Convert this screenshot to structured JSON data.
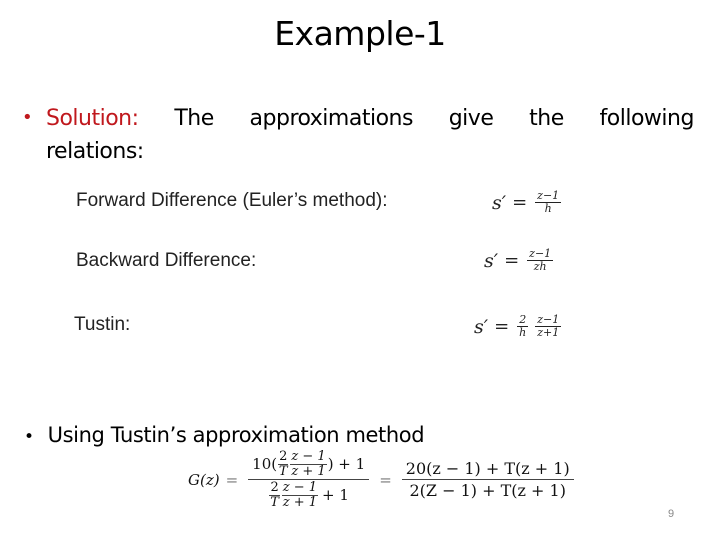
{
  "slide": {
    "title": "Example-1",
    "page_number": "9",
    "accent_color": "#c0181d"
  },
  "solution": {
    "bullet": "•",
    "label": "Solution:",
    "words_line1": [
      "The",
      "approximations",
      "give",
      "the",
      "following"
    ],
    "line2": "relations:"
  },
  "relations": [
    {
      "label": "Forward Difference (Euler’s method):",
      "lhs": "s′",
      "equals": "=",
      "fractions": [
        {
          "num": "z−1",
          "den": "h"
        }
      ]
    },
    {
      "label": "Backward Difference:",
      "lhs": "s′",
      "equals": "=",
      "fractions": [
        {
          "num": "z−1",
          "den": "zh"
        }
      ]
    },
    {
      "label": "Tustin:",
      "lhs": "s′",
      "equals": "=",
      "fractions": [
        {
          "num": "2",
          "den": "h"
        },
        {
          "num": "z−1",
          "den": "z+1"
        }
      ]
    }
  ],
  "tustin_section": {
    "bullet": "•",
    "text": "Using Tustin’s approximation method",
    "equation": {
      "lhs": "G(z)",
      "equals": "=",
      "first_fraction": {
        "numerator": {
          "prefix": "10(",
          "frac_a": {
            "num": "2",
            "den": "T"
          },
          "frac_b": {
            "num": "z − 1",
            "den": "z + 1"
          },
          "suffix": ") + 1"
        },
        "denominator": {
          "frac_a": {
            "num": "2",
            "den": "T"
          },
          "frac_b": {
            "num": "z − 1",
            "den": "z + 1"
          },
          "suffix": "+ 1"
        }
      },
      "equals2": "=",
      "second_fraction": {
        "numerator": "20(z − 1) + T(z + 1)",
        "denominator": "2(Z − 1) + T(z + 1)"
      }
    }
  }
}
